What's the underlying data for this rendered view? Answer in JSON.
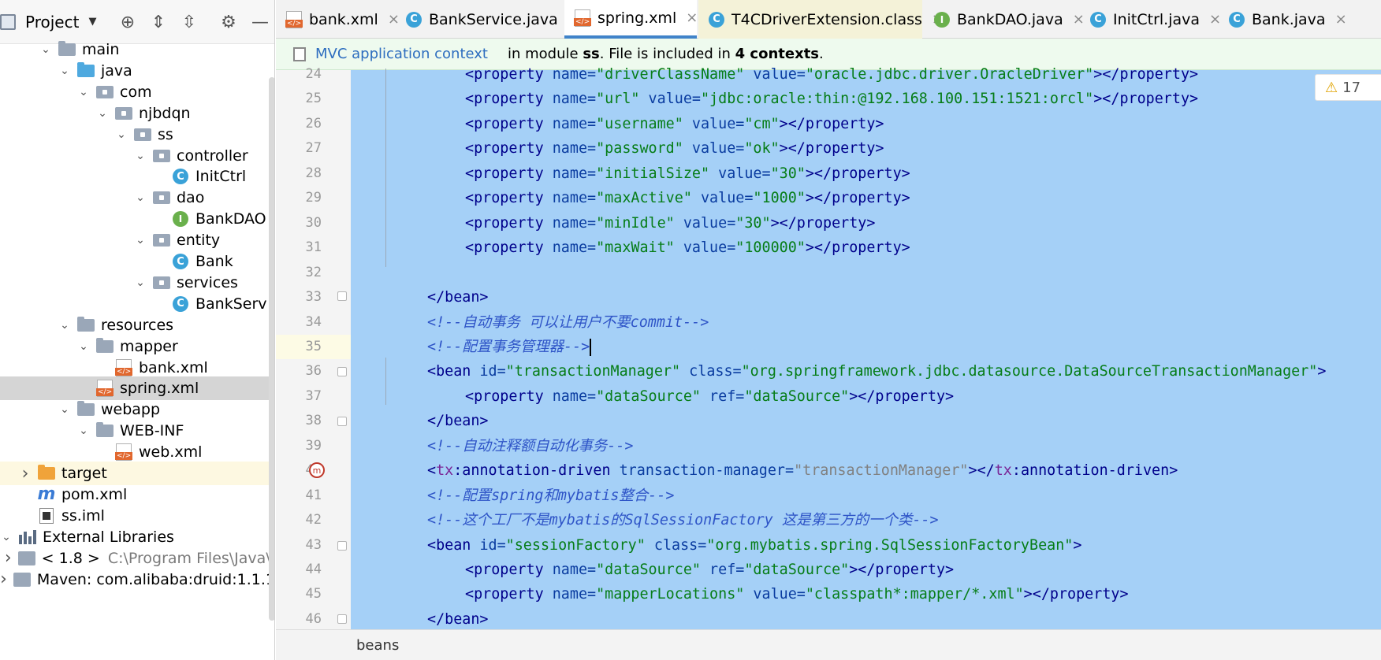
{
  "project_panel": {
    "title": "Project",
    "tree": [
      {
        "label": "main",
        "arrow": "down",
        "icon": "folder"
      },
      {
        "label": "java",
        "arrow": "down",
        "icon": "folder-blue"
      },
      {
        "label": "com",
        "arrow": "down",
        "icon": "package"
      },
      {
        "label": "njbdqn",
        "arrow": "down",
        "icon": "package"
      },
      {
        "label": "ss",
        "arrow": "down",
        "icon": "package"
      },
      {
        "label": "controller",
        "arrow": "down",
        "icon": "package"
      },
      {
        "label": "InitCtrl",
        "arrow": "",
        "icon": "class"
      },
      {
        "label": "dao",
        "arrow": "down",
        "icon": "package"
      },
      {
        "label": "BankDAO",
        "arrow": "",
        "icon": "interface"
      },
      {
        "label": "entity",
        "arrow": "down",
        "icon": "package"
      },
      {
        "label": "Bank",
        "arrow": "",
        "icon": "class"
      },
      {
        "label": "services",
        "arrow": "down",
        "icon": "package"
      },
      {
        "label": "BankServ",
        "arrow": "",
        "icon": "class"
      },
      {
        "label": "resources",
        "arrow": "down",
        "icon": "folder"
      },
      {
        "label": "mapper",
        "arrow": "down",
        "icon": "folder"
      },
      {
        "label": "bank.xml",
        "arrow": "",
        "icon": "xml"
      },
      {
        "label": "spring.xml",
        "arrow": "",
        "icon": "xml",
        "selected": true
      },
      {
        "label": "webapp",
        "arrow": "down",
        "icon": "folder"
      },
      {
        "label": "WEB-INF",
        "arrow": "down",
        "icon": "folder"
      },
      {
        "label": "web.xml",
        "arrow": "",
        "icon": "xml"
      },
      {
        "label": "target",
        "arrow": "right",
        "icon": "folder-orange",
        "highlight": true
      },
      {
        "label": "pom.xml",
        "arrow": "",
        "icon": "maven"
      },
      {
        "label": "ss.iml",
        "arrow": "",
        "icon": "iml"
      },
      {
        "label": "External Libraries",
        "arrow": "down",
        "icon": "libraries"
      },
      {
        "label": "< 1.8 >",
        "extra": "C:\\Program Files\\Java\\j",
        "arrow": "right",
        "icon": "jdk"
      },
      {
        "label": "Maven: com.alibaba:druid:1.1.1",
        "arrow": "right",
        "icon": "jdk"
      }
    ]
  },
  "tabs": [
    {
      "label": "bank.xml",
      "icon": "xml"
    },
    {
      "label": "BankService.java",
      "icon": "class"
    },
    {
      "label": "spring.xml",
      "icon": "xml",
      "active": true
    },
    {
      "label": "T4CDriverExtension.class",
      "icon": "class"
    },
    {
      "label": "BankDAO.java",
      "icon": "interface"
    },
    {
      "label": "InitCtrl.java",
      "icon": "class"
    },
    {
      "label": "Bank.java",
      "icon": "class"
    }
  ],
  "context_bar": {
    "link": "MVC application context",
    "prefix": "in module ",
    "module": "ss",
    "middle": ". File is included in ",
    "contexts": "4 contexts",
    "suffix": "."
  },
  "warnings_count": "17",
  "editor": {
    "lines": [
      {
        "n": "24",
        "indent": 2,
        "parts": [
          [
            "t",
            "<property "
          ],
          [
            "a",
            "name="
          ],
          [
            "v",
            "\"driverClassName\" "
          ],
          [
            "a",
            "value="
          ],
          [
            "v",
            "\"oracle.jdbc.driver.OracleDriver\""
          ],
          [
            "t",
            "></property>"
          ]
        ]
      },
      {
        "n": "25",
        "indent": 2,
        "parts": [
          [
            "t",
            "<property "
          ],
          [
            "a",
            "name="
          ],
          [
            "v",
            "\"url\" "
          ],
          [
            "a",
            "value="
          ],
          [
            "v",
            "\"jdbc:oracle:thin:@192.168.100.151:1521:orcl\""
          ],
          [
            "t",
            "></property>"
          ]
        ]
      },
      {
        "n": "26",
        "indent": 2,
        "parts": [
          [
            "t",
            "<property "
          ],
          [
            "a",
            "name="
          ],
          [
            "v",
            "\"username\" "
          ],
          [
            "a",
            "value="
          ],
          [
            "v",
            "\"cm\""
          ],
          [
            "t",
            "></property>"
          ]
        ]
      },
      {
        "n": "27",
        "indent": 2,
        "parts": [
          [
            "t",
            "<property "
          ],
          [
            "a",
            "name="
          ],
          [
            "v",
            "\"password\" "
          ],
          [
            "a",
            "value="
          ],
          [
            "v",
            "\"ok\""
          ],
          [
            "t",
            "></property>"
          ]
        ]
      },
      {
        "n": "28",
        "indent": 2,
        "parts": [
          [
            "t",
            "<property "
          ],
          [
            "a",
            "name="
          ],
          [
            "v",
            "\"initialSize\" "
          ],
          [
            "a",
            "value="
          ],
          [
            "v",
            "\"30\""
          ],
          [
            "t",
            "></property>"
          ]
        ]
      },
      {
        "n": "29",
        "indent": 2,
        "parts": [
          [
            "t",
            "<property "
          ],
          [
            "a",
            "name="
          ],
          [
            "v",
            "\"maxActive\" "
          ],
          [
            "a",
            "value="
          ],
          [
            "v",
            "\"1000\""
          ],
          [
            "t",
            "></property>"
          ]
        ]
      },
      {
        "n": "30",
        "indent": 2,
        "parts": [
          [
            "t",
            "<property "
          ],
          [
            "a",
            "name="
          ],
          [
            "v",
            "\"minIdle\" "
          ],
          [
            "a",
            "value="
          ],
          [
            "v",
            "\"30\""
          ],
          [
            "t",
            "></property>"
          ]
        ]
      },
      {
        "n": "31",
        "indent": 2,
        "parts": [
          [
            "t",
            "<property "
          ],
          [
            "a",
            "name="
          ],
          [
            "v",
            "\"maxWait\" "
          ],
          [
            "a",
            "value="
          ],
          [
            "v",
            "\"100000\""
          ],
          [
            "t",
            "></property>"
          ]
        ]
      },
      {
        "n": "32",
        "indent": 0,
        "parts": []
      },
      {
        "n": "33",
        "indent": 1,
        "parts": [
          [
            "t",
            "</bean>"
          ]
        ]
      },
      {
        "n": "34",
        "indent": 1,
        "parts": [
          [
            "c",
            "<!--自动事务 可以让用户不要commit-->"
          ]
        ]
      },
      {
        "n": "35",
        "indent": 1,
        "parts": [
          [
            "c",
            "<!--配置事务管理器-->"
          ]
        ],
        "caret": true
      },
      {
        "n": "36",
        "indent": 1,
        "parts": [
          [
            "t",
            "<bean "
          ],
          [
            "a",
            "id="
          ],
          [
            "v",
            "\"transactionManager\" "
          ],
          [
            "a",
            "class="
          ],
          [
            "v",
            "\"org.springframework.jdbc.datasource.DataSourceTransactionManager\""
          ],
          [
            "t",
            ">"
          ]
        ]
      },
      {
        "n": "37",
        "indent": 2,
        "parts": [
          [
            "t",
            "<property "
          ],
          [
            "a",
            "name="
          ],
          [
            "v",
            "\"dataSource\" "
          ],
          [
            "a",
            "ref="
          ],
          [
            "v",
            "\"dataSource\""
          ],
          [
            "t",
            "></property>"
          ]
        ]
      },
      {
        "n": "38",
        "indent": 1,
        "parts": [
          [
            "t",
            "</bean>"
          ]
        ]
      },
      {
        "n": "39",
        "indent": 1,
        "parts": [
          [
            "c",
            "<!--自动注释额自动化事务-->"
          ]
        ]
      },
      {
        "n": "40",
        "indent": 1,
        "parts": [
          [
            "t",
            "<"
          ],
          [
            "ns",
            "tx"
          ],
          [
            "t",
            ":annotation-driven "
          ],
          [
            "a",
            "transaction-manager="
          ],
          [
            "vg",
            "\"transactionManager\""
          ],
          [
            "t",
            "></"
          ],
          [
            "ns",
            "tx"
          ],
          [
            "t",
            ":annotation-driven>"
          ]
        ]
      },
      {
        "n": "41",
        "indent": 1,
        "parts": [
          [
            "c",
            "<!--配置spring和mybatis整合-->"
          ]
        ]
      },
      {
        "n": "42",
        "indent": 1,
        "parts": [
          [
            "c",
            "<!--这个工厂不是mybatis的SqlSessionFactory 这是第三方的一个类-->"
          ]
        ]
      },
      {
        "n": "43",
        "indent": 1,
        "parts": [
          [
            "t",
            "<bean "
          ],
          [
            "a",
            "id="
          ],
          [
            "v",
            "\"sessionFactory\" "
          ],
          [
            "a",
            "class="
          ],
          [
            "v",
            "\"org.mybatis.spring.SqlSessionFactoryBean\""
          ],
          [
            "t",
            ">"
          ]
        ]
      },
      {
        "n": "44",
        "indent": 2,
        "parts": [
          [
            "t",
            "<property "
          ],
          [
            "a",
            "name="
          ],
          [
            "v",
            "\"dataSource\" "
          ],
          [
            "a",
            "ref="
          ],
          [
            "v",
            "\"dataSource\""
          ],
          [
            "t",
            "></property>"
          ]
        ]
      },
      {
        "n": "45",
        "indent": 2,
        "parts": [
          [
            "t",
            "<property "
          ],
          [
            "a",
            "name="
          ],
          [
            "v",
            "\"mapperLocations\" "
          ],
          [
            "a",
            "value="
          ],
          [
            "v",
            "\"classpath*:mapper/*.xml\""
          ],
          [
            "t",
            "></property>"
          ]
        ]
      },
      {
        "n": "46",
        "indent": 1,
        "parts": [
          [
            "t",
            "</bean>"
          ]
        ]
      }
    ]
  },
  "breadcrumb": "beans",
  "colors": {
    "selection": "#a5d0f7",
    "tag": "#00008b",
    "attr": "#0a3ca0",
    "value": "#067d17",
    "comment": "#2e54c7",
    "accent": "#4083c9"
  }
}
